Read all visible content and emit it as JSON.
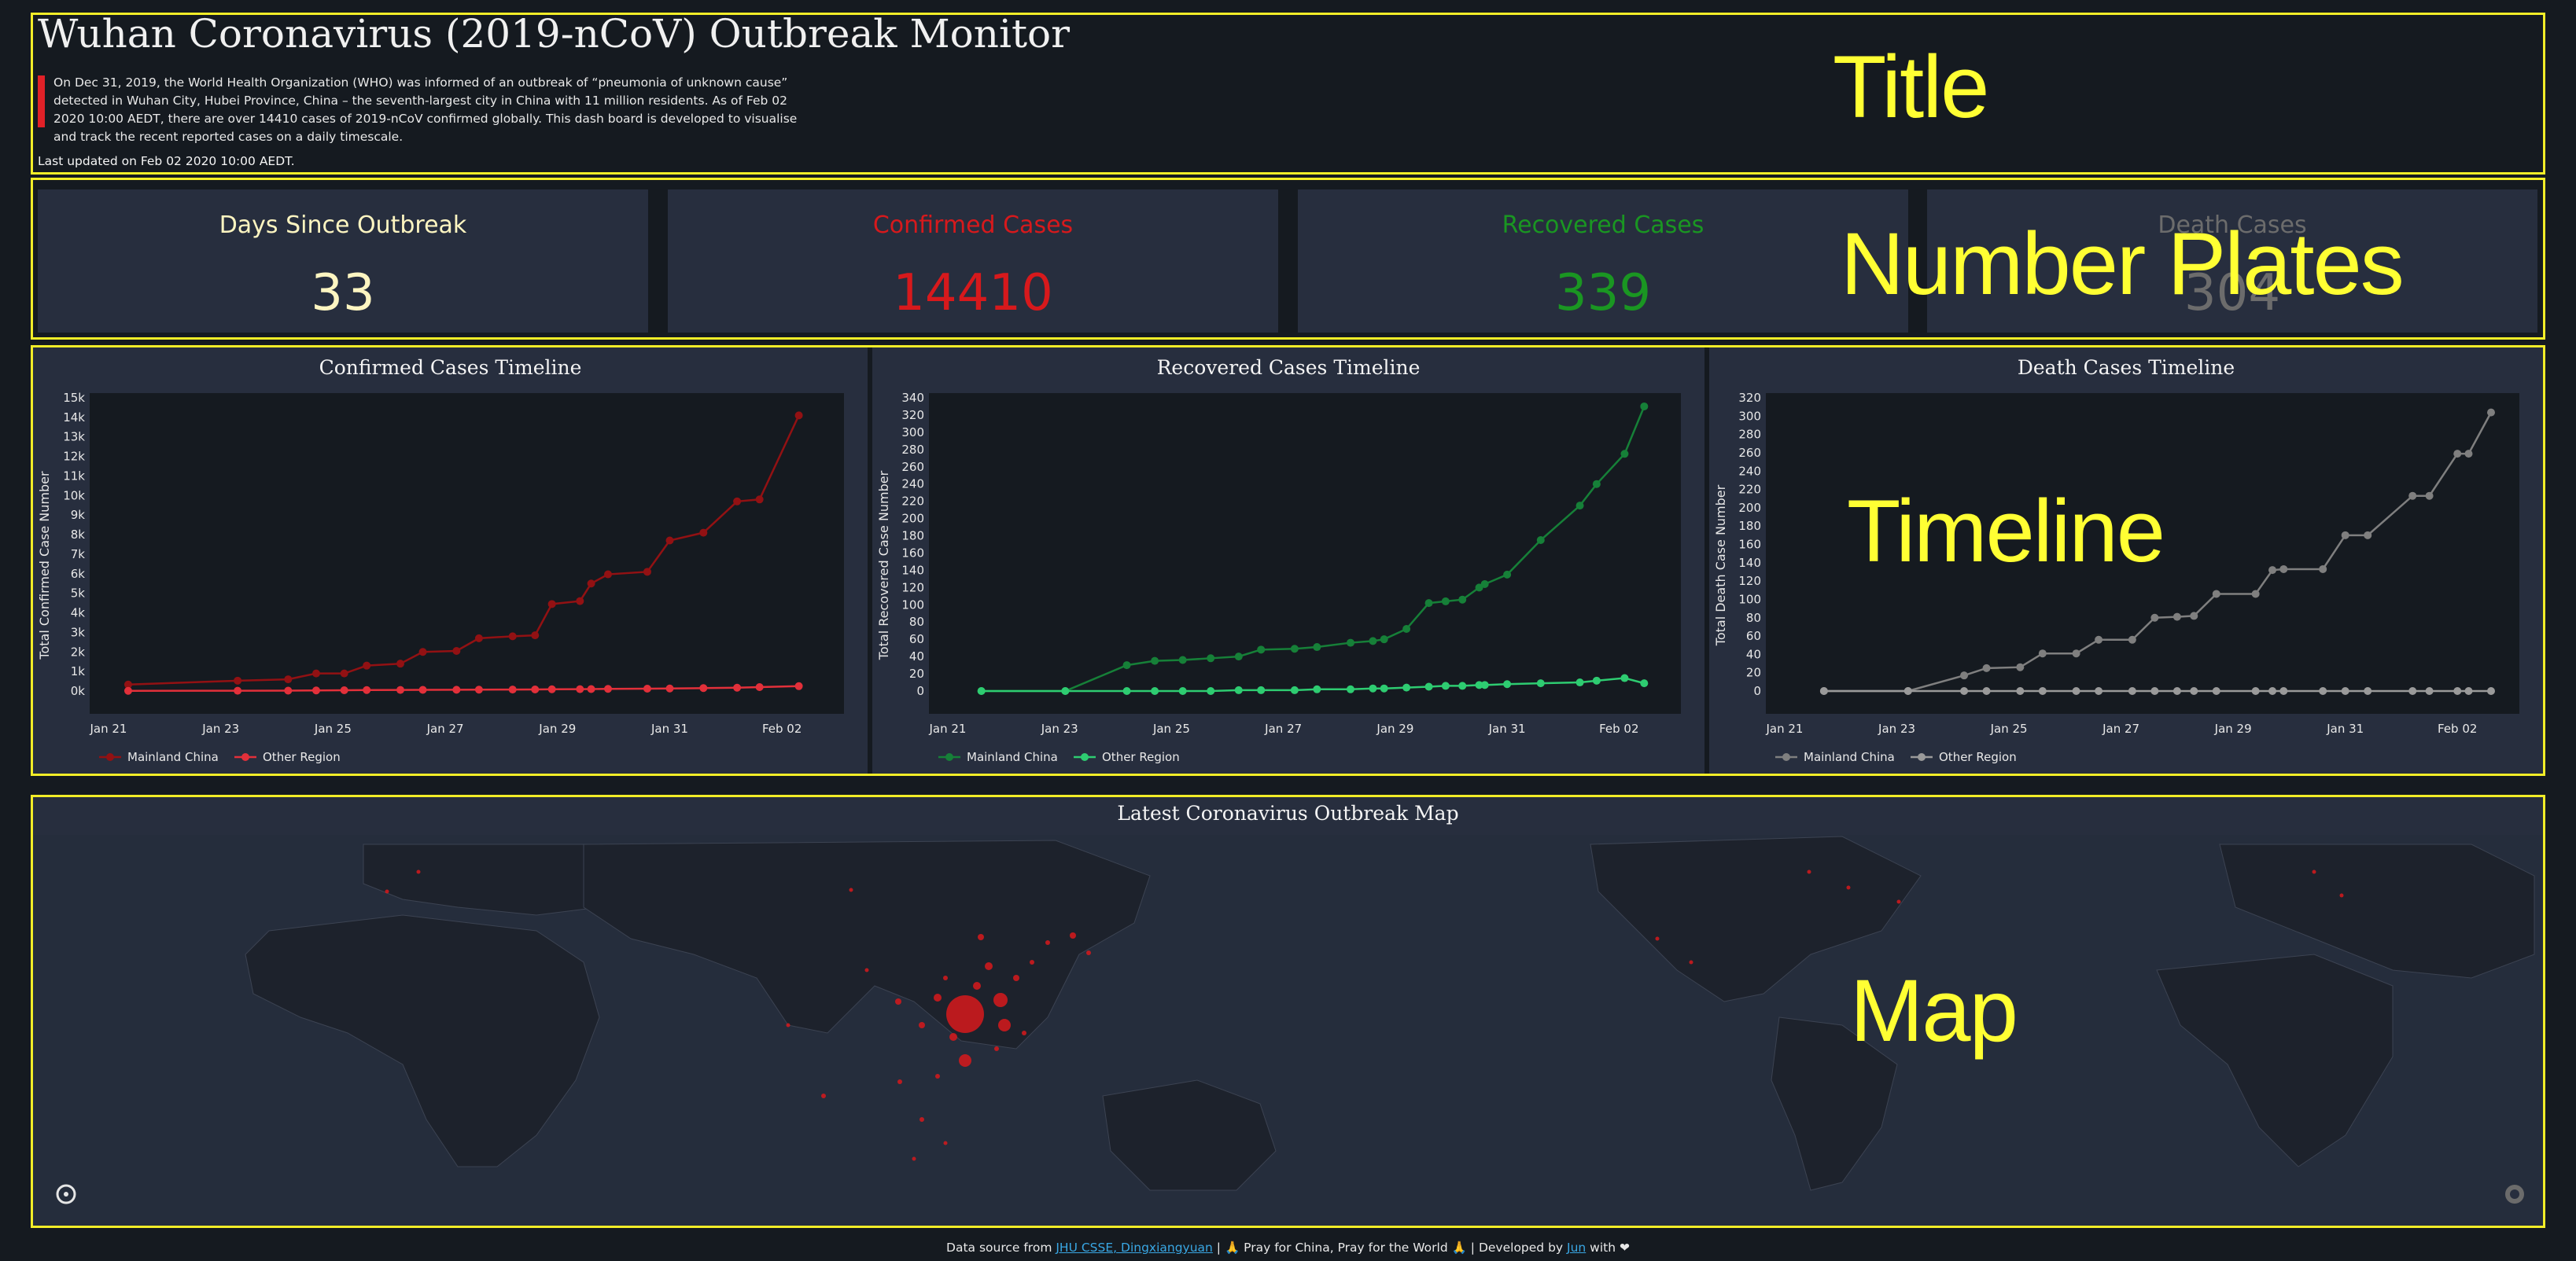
{
  "header": {
    "title": "Wuhan Coronavirus (2019-nCoV) Outbreak Monitor",
    "description": "On Dec 31, 2019, the World Health Organization (WHO) was informed of an outbreak of “pneumonia of unknown cause” detected in Wuhan City, Hubei Province, China – the seventh-largest city in China with 11 million residents. As of Feb 02 2020 10:00 AEDT, there are over 14410 cases of 2019-nCoV confirmed globally. This dash board is developed to visualise and track the recent reported cases on a daily timescale.",
    "last_updated": "Last updated on Feb 02 2020 10:00 AEDT."
  },
  "annotations": {
    "title": "Title",
    "plates": "Number Plates",
    "timeline": "Timeline",
    "map": "Map"
  },
  "plates": [
    {
      "label": "Days Since Outbreak",
      "value": "33",
      "color": "#fdf5c1"
    },
    {
      "label": "Confirmed Cases",
      "value": "14410",
      "color": "#d7191c"
    },
    {
      "label": "Recovered Cases",
      "value": "339",
      "color": "#1a9622"
    },
    {
      "label": "Death Cases",
      "value": "304",
      "color": "#6c6c6c"
    }
  ],
  "charts": [
    {
      "title": "Confirmed Cases Timeline",
      "ylabel": "Total Confirmed Case Number",
      "color_main": "#921113",
      "color_other": "#e2303a",
      "yticks": [
        "15k",
        "14k",
        "13k",
        "12k",
        "11k",
        "10k",
        "9k",
        "8k",
        "7k",
        "6k",
        "5k",
        "4k",
        "3k",
        "2k",
        "1k",
        "0k"
      ]
    },
    {
      "title": "Recovered Cases Timeline",
      "ylabel": "Total Recovered Case Number",
      "color_main": "#168038",
      "color_other": "#2ecc71",
      "yticks": [
        "340",
        "320",
        "300",
        "280",
        "260",
        "240",
        "220",
        "200",
        "180",
        "160",
        "140",
        "120",
        "100",
        "80",
        "60",
        "40",
        "20",
        "0"
      ]
    },
    {
      "title": "Death Cases Timeline",
      "ylabel": "Total Death Case Number",
      "color_main": "#7f7f7f",
      "color_other": "#9a9a9a",
      "yticks": [
        "320",
        "300",
        "280",
        "260",
        "240",
        "220",
        "200",
        "180",
        "160",
        "140",
        "120",
        "100",
        "80",
        "60",
        "40",
        "20",
        "0"
      ]
    }
  ],
  "xticks": [
    "Jan 21",
    "Jan 23",
    "Jan 25",
    "Jan 27",
    "Jan 29",
    "Jan 31",
    "Feb 02"
  ],
  "legend": {
    "main": "Mainland China",
    "other": "Other Region"
  },
  "map": {
    "title": "Latest Coronavirus Outbreak Map"
  },
  "footer": {
    "prefix": "Data source from ",
    "sources": "JHU CSSE, Dingxiangyuan",
    "middle": " | 🙏 Pray for China, Pray for the World 🙏  | Developed by ",
    "author": "Jun",
    "suffix": " with ❤"
  },
  "chart_data": [
    {
      "type": "line",
      "title": "Confirmed Cases Timeline",
      "ylabel": "Total Confirmed Case Number",
      "x": [
        "2020-01-21",
        "2020-01-23",
        "2020-01-24",
        "2020-01-25",
        "2020-01-25T12",
        "2020-01-26",
        "2020-01-26T12",
        "2020-01-27",
        "2020-01-27T12",
        "2020-01-28",
        "2020-01-28T12",
        "2020-01-28T18",
        "2020-01-29",
        "2020-01-29T12",
        "2020-01-29T18",
        "2020-01-30",
        "2020-01-30T12",
        "2020-01-31",
        "2020-01-31T12",
        "2020-02-01",
        "2020-02-01T12",
        "2020-02-02"
      ],
      "series": [
        {
          "name": "Mainland China",
          "values": [
            330,
            530,
            600,
            900,
            900,
            1300,
            1400,
            2000,
            2050,
            2700,
            2800,
            2850,
            4450,
            4600,
            5500,
            5970,
            6100,
            7700,
            8100,
            9700,
            9800,
            14100
          ]
        },
        {
          "name": "Other Region",
          "values": [
            10,
            15,
            20,
            30,
            40,
            50,
            55,
            60,
            65,
            70,
            75,
            80,
            90,
            95,
            100,
            110,
            120,
            130,
            150,
            170,
            200,
            250
          ]
        }
      ],
      "ylim": [
        0,
        15000
      ]
    },
    {
      "type": "line",
      "title": "Recovered Cases Timeline",
      "ylabel": "Total Recovered Case Number",
      "series": [
        {
          "name": "Mainland China",
          "values": [
            0,
            0,
            30,
            35,
            36,
            38,
            40,
            48,
            49,
            51,
            56,
            58,
            60,
            72,
            102,
            104,
            106,
            120,
            124,
            135,
            175,
            215,
            240,
            275,
            330
          ]
        },
        {
          "name": "Other Region",
          "values": [
            0,
            0,
            0,
            0,
            0,
            0,
            1,
            1,
            1,
            2,
            2,
            3,
            3,
            4,
            5,
            6,
            6,
            7,
            7,
            8,
            9,
            10,
            12,
            15,
            9
          ]
        }
      ],
      "ylim": [
        0,
        340
      ]
    },
    {
      "type": "line",
      "title": "Death Cases Timeline",
      "ylabel": "Total Death Case Number",
      "series": [
        {
          "name": "Mainland China",
          "values": [
            0,
            0,
            17,
            25,
            26,
            41,
            41,
            56,
            56,
            80,
            81,
            82,
            106,
            106,
            132,
            133,
            133,
            170,
            170,
            213,
            213,
            259,
            259,
            304
          ]
        },
        {
          "name": "Other Region",
          "values": [
            0,
            0,
            0,
            0,
            0,
            0,
            0,
            0,
            0,
            0,
            0,
            0,
            0,
            0,
            0,
            0,
            0,
            0,
            0,
            0,
            0,
            0,
            0,
            0
          ]
        }
      ],
      "ylim": [
        0,
        320
      ]
    }
  ]
}
